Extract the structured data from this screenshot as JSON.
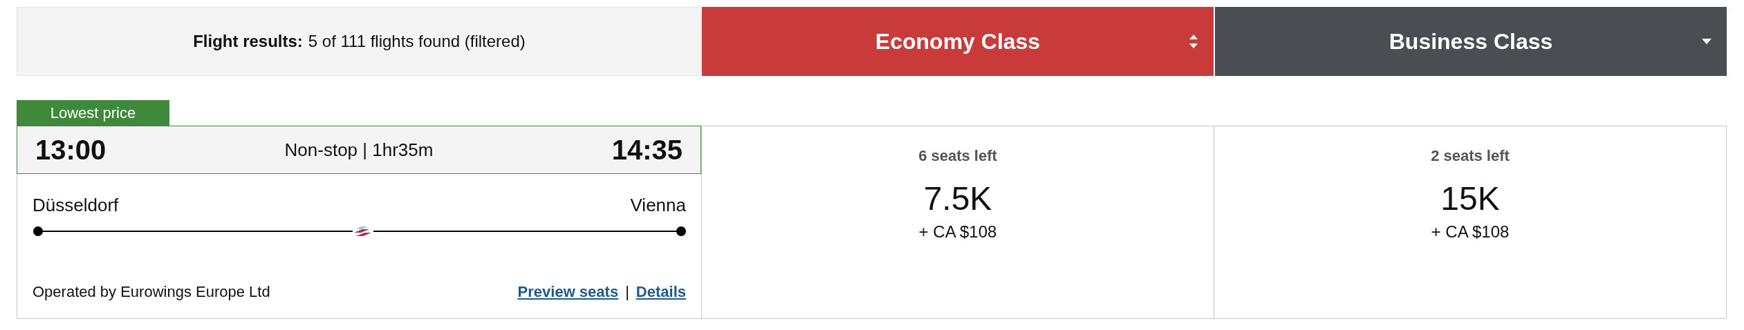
{
  "results": {
    "label": "Flight results:",
    "summary": "5 of 111 flights found (filtered)"
  },
  "cabins": [
    {
      "label": "Economy Class",
      "selected": true
    },
    {
      "label": "Business Class",
      "selected": false
    }
  ],
  "flights": [
    {
      "badge": "Lowest price",
      "depart": "13:00",
      "stops": "Non-stop | 1hr35m",
      "arrive": "14:35",
      "origin": "Düsseldorf",
      "destination": "Vienna",
      "operator": "Operated by Eurowings Europe Ltd",
      "links": [
        "Preview seats",
        "Details"
      ],
      "link_separator": "|",
      "fares": [
        {
          "seats": "6 seats left",
          "points": "7.5K",
          "cash": "+ CA $108"
        },
        {
          "seats": "2 seats left",
          "points": "15K",
          "cash": "+ CA $108"
        }
      ]
    }
  ]
}
